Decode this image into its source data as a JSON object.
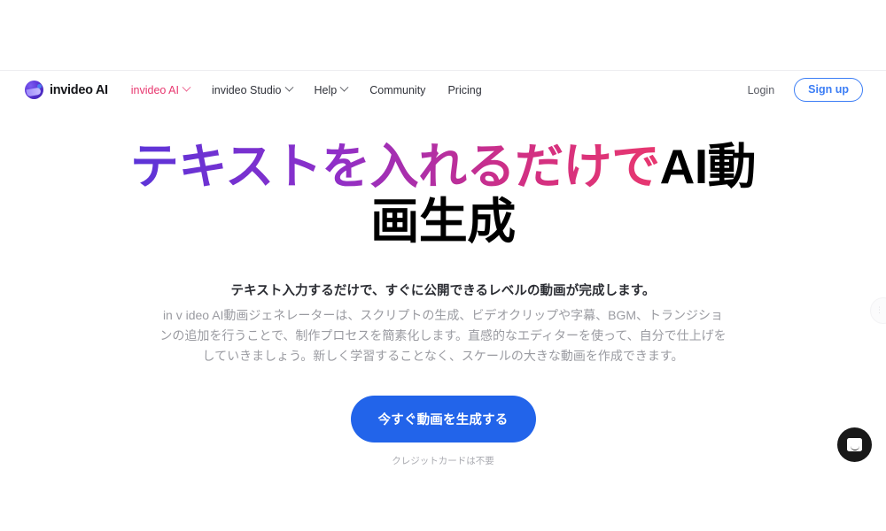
{
  "brand": {
    "name": "invideo AI",
    "logo_icon": "invideo-logo-icon"
  },
  "nav": {
    "items": [
      {
        "label": "invideo AI",
        "has_chevron": true,
        "active": true
      },
      {
        "label": "invideo Studio",
        "has_chevron": true,
        "active": false
      },
      {
        "label": "Help",
        "has_chevron": true,
        "active": false
      },
      {
        "label": "Community",
        "has_chevron": false,
        "active": false
      },
      {
        "label": "Pricing",
        "has_chevron": false,
        "active": false
      }
    ],
    "login_label": "Login",
    "signup_label": "Sign up"
  },
  "hero": {
    "headline_gradient": "テキストを入れるだけで",
    "headline_black_1": "AI動",
    "headline_black_2": "画生成",
    "sub_lead": "テキスト入力するだけで、すぐに公開できるレベルの動画が完成します。",
    "sub_body": "in v ideo AI動画ジェネレーターは、スクリプトの生成、ビデオクリップや字幕、BGM、トランジションの追加を行うことで、制作プロセスを簡素化します。直感的なエディターを使って、自分で仕上げをしていきましょう。新しく学習することなく、スケールの大きな動画を作成できます。",
    "cta_label": "今すぐ動画を生成する",
    "cta_note": "クレジットカードは不要"
  },
  "widgets": {
    "side_tab_glyph": "⋮⋮",
    "chat_icon": "chat-bubble-icon"
  },
  "colors": {
    "gradient_start": "#5b34d8",
    "gradient_end": "#e8376f",
    "accent_pink": "#e8376f",
    "cta_blue": "#2264ea",
    "signup_blue": "#3b7df5",
    "body_gray": "#9a9ba1"
  }
}
